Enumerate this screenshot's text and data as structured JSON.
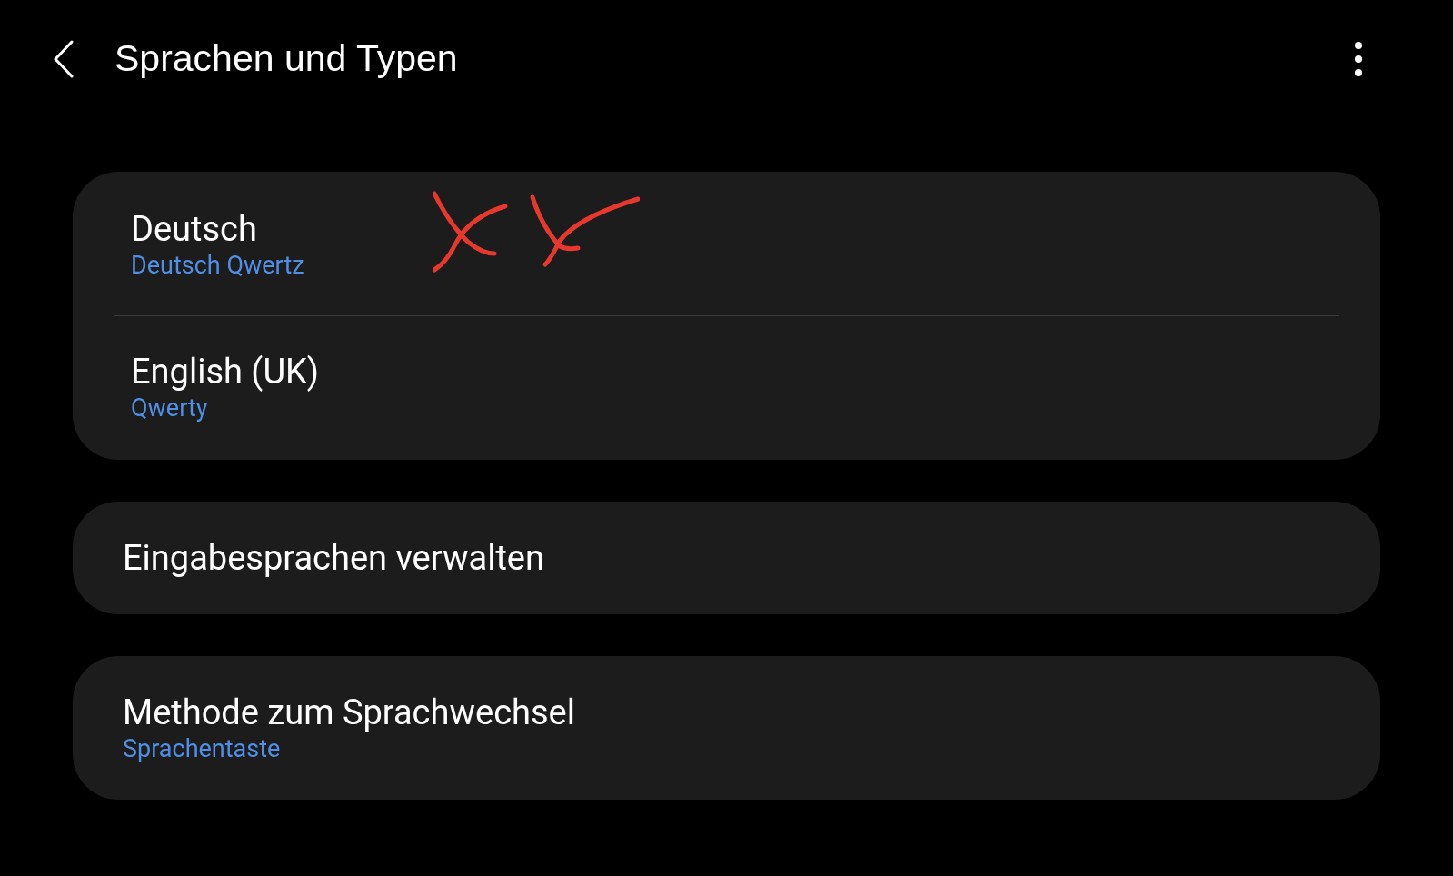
{
  "header": {
    "title": "Sprachen und Typen"
  },
  "groups": [
    {
      "items": [
        {
          "title": "Deutsch",
          "subtitle": "Deutsch Qwertz"
        },
        {
          "title": "English (UK)",
          "subtitle": "Qwerty"
        }
      ]
    },
    {
      "items": [
        {
          "title": "Eingabesprachen verwalten"
        }
      ]
    },
    {
      "items": [
        {
          "title": "Methode zum Sprachwechsel",
          "subtitle": "Sprachentaste"
        }
      ]
    }
  ]
}
